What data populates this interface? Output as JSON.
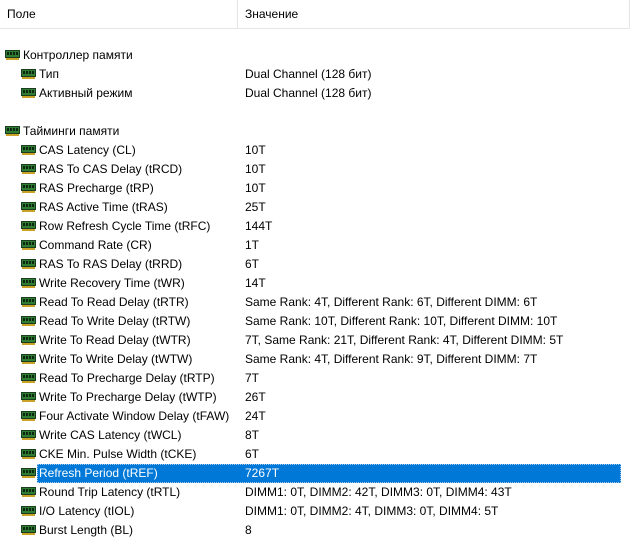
{
  "header": {
    "field": "Поле",
    "value": "Значение"
  },
  "sections": [
    {
      "title": "Контроллер памяти",
      "items": [
        {
          "label": "Тип",
          "value": "Dual Channel  (128 бит)"
        },
        {
          "label": "Активный режим",
          "value": "Dual Channel  (128 бит)"
        }
      ]
    },
    {
      "title": "Тайминги памяти",
      "items": [
        {
          "label": "CAS Latency (CL)",
          "value": "10T"
        },
        {
          "label": "RAS To CAS Delay (tRCD)",
          "value": "10T"
        },
        {
          "label": "RAS Precharge (tRP)",
          "value": "10T"
        },
        {
          "label": "RAS Active Time (tRAS)",
          "value": "25T"
        },
        {
          "label": "Row Refresh Cycle Time (tRFC)",
          "value": "144T"
        },
        {
          "label": "Command Rate (CR)",
          "value": "1T"
        },
        {
          "label": "RAS To RAS Delay (tRRD)",
          "value": "6T"
        },
        {
          "label": "Write Recovery Time (tWR)",
          "value": "14T"
        },
        {
          "label": "Read To Read Delay (tRTR)",
          "value": "Same Rank: 4T, Different Rank: 6T, Different DIMM: 6T"
        },
        {
          "label": "Read To Write Delay (tRTW)",
          "value": "Same Rank: 10T, Different Rank: 10T, Different DIMM: 10T"
        },
        {
          "label": "Write To Read Delay (tWTR)",
          "value": "7T, Same Rank: 21T, Different Rank: 4T, Different DIMM: 5T"
        },
        {
          "label": "Write To Write Delay (tWTW)",
          "value": "Same Rank: 4T, Different Rank: 9T, Different DIMM: 7T"
        },
        {
          "label": "Read To Precharge Delay (tRTP)",
          "value": "7T"
        },
        {
          "label": "Write To Precharge Delay (tWTP)",
          "value": "26T"
        },
        {
          "label": "Four Activate Window Delay (tFAW)",
          "value": "24T"
        },
        {
          "label": "Write CAS Latency (tWCL)",
          "value": "8T"
        },
        {
          "label": "CKE Min. Pulse Width (tCKE)",
          "value": "6T"
        },
        {
          "label": "Refresh Period (tREF)",
          "value": "7267T",
          "selected": true
        },
        {
          "label": "Round Trip Latency (tRTL)",
          "value": "DIMM1: 0T, DIMM2: 42T, DIMM3: 0T, DIMM4: 43T"
        },
        {
          "label": "I/O Latency (tIOL)",
          "value": "DIMM1: 0T, DIMM2: 4T, DIMM3: 0T, DIMM4: 5T"
        },
        {
          "label": "Burst Length (BL)",
          "value": "8"
        }
      ]
    }
  ],
  "colors": {
    "selection": "#0078d7",
    "memory_icon_green": "#2e7d32",
    "memory_icon_dark": "#1b3d1f"
  },
  "icons": {
    "section": "memory-module-icon",
    "item": "memory-module-icon"
  }
}
